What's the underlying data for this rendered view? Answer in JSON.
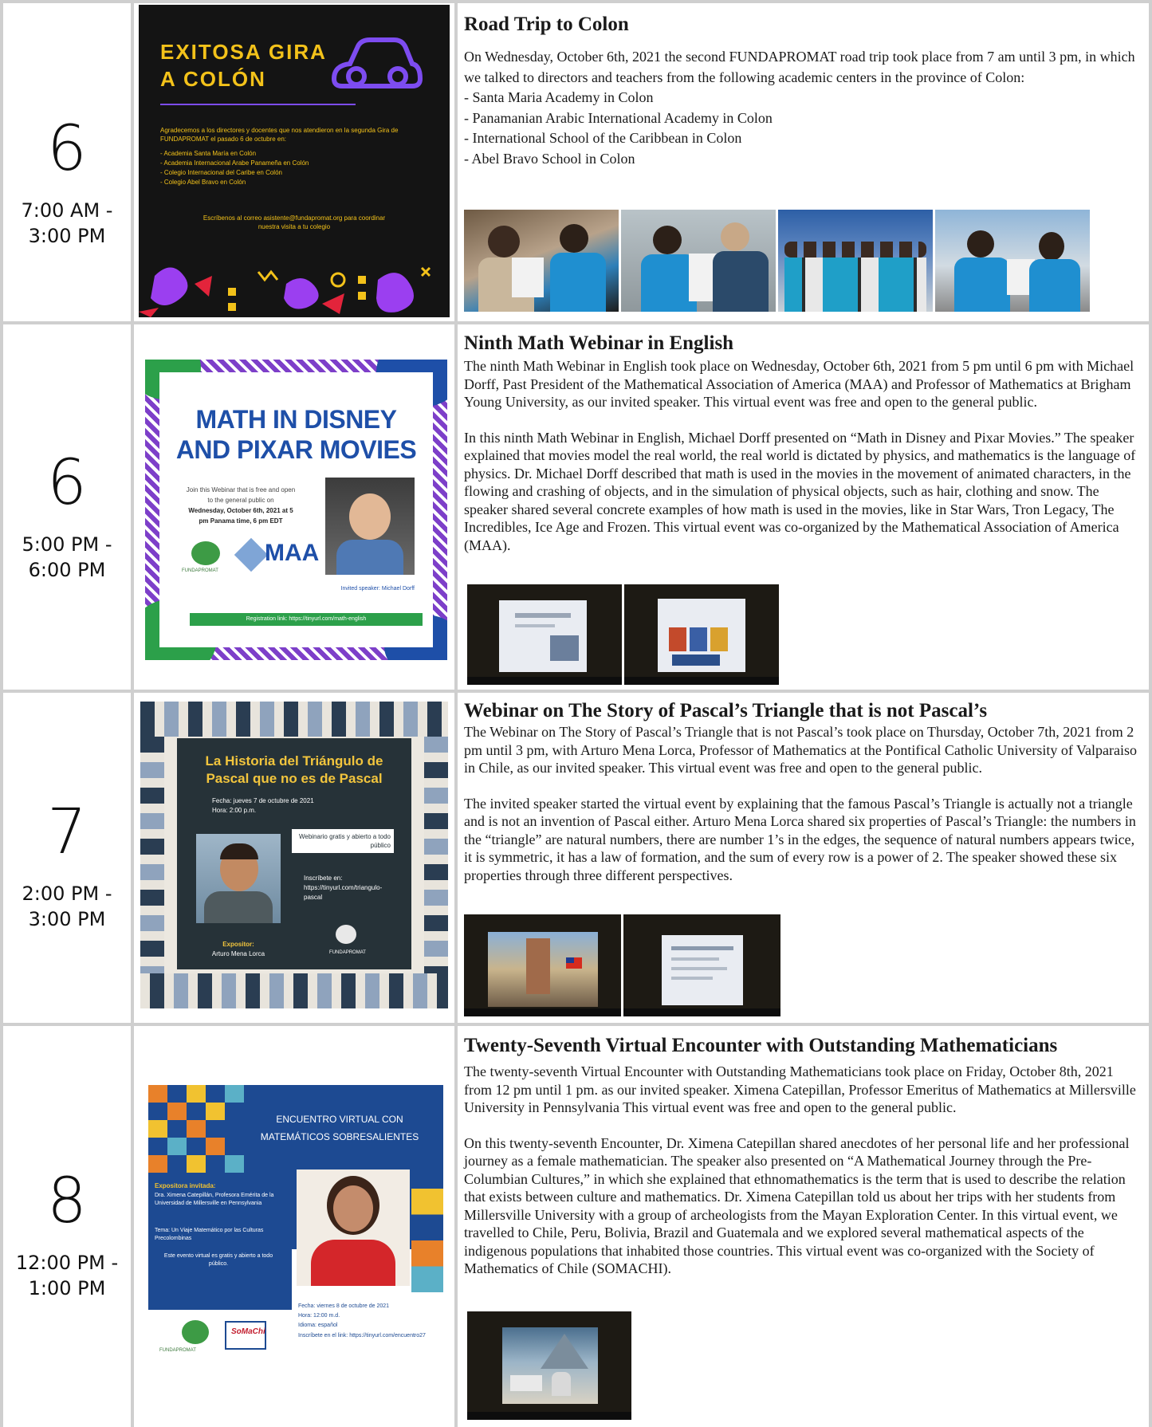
{
  "events": [
    {
      "day": "6",
      "time": "7:00 AM -\n3:00 PM",
      "title": "Road Trip to Colon",
      "paragraphs": [
        "On Wednesday, October 6th, 2021 the second FUNDAPROMAT road trip took place from 7 am until 3 pm, in which we talked to directors and teachers from the following academic centers in the province of Colon:"
      ],
      "list": [
        "- Santa Maria Academy in Colon",
        "- Panamanian Arabic International Academy in Colon",
        "- International School of the Caribbean in Colon",
        "- Abel Bravo School in Colon"
      ],
      "poster": {
        "headline": "EXITOSA GIRA\nA COLÓN",
        "body": "Agradecemos a los directores y docentes que nos atendieron en la segunda Gira de FUNDAPROMAT el pasado 6 de octubre en:",
        "items": [
          "- Academia Santa María en Colón",
          "- Academia Internacional Arabe Panameña en Colón",
          "- Colegio Internacional del Caribe en Colón",
          "- Colegio Abel Bravo en Colón"
        ],
        "cta": "Escríbenos al correo asistente@fundapromat.org para coordinar nuestra visita a tu colegio"
      }
    },
    {
      "day": "6",
      "time": "5:00 PM -\n6:00 PM",
      "title": "Ninth Math Webinar in English",
      "paragraphs": [
        "The ninth Math Webinar in English took place on Wednesday, October 6th, 2021 from 5 pm until 6 pm with Michael Dorff, Past President of the Mathematical Association of America (MAA) and Professor of Mathematics at Brigham Young University, as our invited speaker. This virtual event was free and open to the general public.",
        "In this ninth Math Webinar in English, Michael Dorff presented on “Math in Disney and Pixar Movies.” The speaker explained that movies model the real world, the real world is dictated by physics, and mathematics is the language of physics. Dr. Michael Dorff described that math is used in the movies in the movement of animated characters, in the flowing and crashing of objects, and in the simulation of physical objects, such as hair, clothing and snow. The speaker shared several concrete examples of how math is used in the movies, like in Star Wars, Tron Legacy, The Incredibles, Ice Age and Frozen. This virtual event was co-organized by the Mathematical Association of America (MAA)."
      ],
      "poster": {
        "headline": "MATH IN DISNEY\nAND PIXAR MOVIES",
        "body": "Join this Webinar that is free and open to the general public on",
        "date": "Wednesday, October 6th, 2021 at 5 pm Panama time, 6 pm EDT",
        "org": "FUNDAPROMAT",
        "maa": "MAA",
        "speaker": "Invited speaker: Michael Dorff",
        "register": "Registration link: https://tinyurl.com/math-english"
      }
    },
    {
      "day": "7",
      "time": "2:00 PM -\n3:00 PM",
      "title": "Webinar on The Story of Pascal’s Triangle that is not Pascal’s",
      "paragraphs": [
        "The Webinar on The Story of Pascal’s Triangle that is not Pascal’s took place on Thursday, October 7th, 2021 from 2 pm until 3 pm, with Arturo Mena Lorca, Professor of Mathematics at the Pontifical Catholic University of Valparaiso in Chile, as our invited speaker. This virtual event was free and open to the general public.",
        "The invited speaker started the virtual event by explaining that the famous Pascal’s Triangle is actually not a triangle and is not an invention of Pascal either. Arturo Mena Lorca shared six properties of Pascal’s Triangle: the numbers in the “triangle” are natural numbers, there are number 1’s in the edges, the sequence of natural numbers appears twice, it is symmetric, it has a law of formation, and the sum of every row is a power of 2. The speaker showed these six properties through three different perspectives."
      ],
      "poster": {
        "headline": "La Historia del Triángulo de Pascal que no es de Pascal",
        "date": "Fecha: jueves 7 de octubre de 2021",
        "hour": "Hora: 2:00 p.m.",
        "free": "Webinario gratis y abierto a todo público",
        "register": "Inscríbete en: https://tinyurl.com/triangulo-pascal",
        "speaker_label": "Expositor:",
        "speaker": "Arturo Mena Lorca",
        "org": "FUNDAPROMAT"
      }
    },
    {
      "day": "8",
      "time": "12:00 PM -\n1:00 PM",
      "title": "Twenty-Seventh Virtual Encounter with Outstanding Mathematicians",
      "paragraphs": [
        "The twenty-seventh Virtual Encounter with Outstanding Mathematicians took place on Friday, October 8th, 2021 from 12 pm until 1 pm. as our invited speaker. Ximena Catepillan, Professor Emeritus of Mathematics at Millersville University in Pennsylvania This virtual event was free and open to the general public.",
        "On this twenty-seventh Encounter, Dr. Ximena Catepillan shared anecdotes of her personal life and her professional journey as a female mathematician. The speaker also presented on “A Mathematical Journey through the Pre-Columbian Cultures,” in which she explained that ethnomathematics is the term that is used to describe the relation that exists between culture and mathematics. Dr. Ximena Catepillan told us about her trips with her students from Millersville University with a group of archeologists from the Mayan Exploration Center. In this virtual event, we travelled to Chile, Peru, Bolivia, Brazil and Guatemala and we explored several mathematical aspects of the indigenous populations that inhabited those countries. This virtual event was co-organized with the Society of Mathematics of Chile (SOMACHI)."
      ],
      "poster": {
        "headline": "ENCUENTRO VIRTUAL CON\nMATEMÁTICOS SOBRESALIENTES",
        "speaker_label": "Expositora invitada:",
        "speaker": "Dra. Ximena Catepillán, Profesora Emérita de la Universidad de Millersville en Pennsylvania",
        "topic": "Tema: Un Viaje Matemático por las Culturas Precolombinas",
        "free": "Este evento virtual es gratis y abierto a todo público.",
        "date": "Fecha: viernes 8 de octubre de 2021",
        "hour": "Hora: 12:00 m.d.",
        "lang": "Idioma: español",
        "register": "Inscríbete en el link: https://tinyurl.com/encuentro27",
        "org": "FUNDAPROMAT",
        "org2": "SoMaChi"
      }
    }
  ],
  "colors": {
    "grid": "#cfcfcf",
    "text": "#1a1a1a",
    "colon_bg": "#141414",
    "colon_accent": "#7d4cf0",
    "colon_yellow": "#f3c21a",
    "disney_blue": "#1e4fa8",
    "disney_green": "#2ca04a",
    "pascal_dark": "#263238",
    "encuentro_blue": "#1d4a92"
  }
}
